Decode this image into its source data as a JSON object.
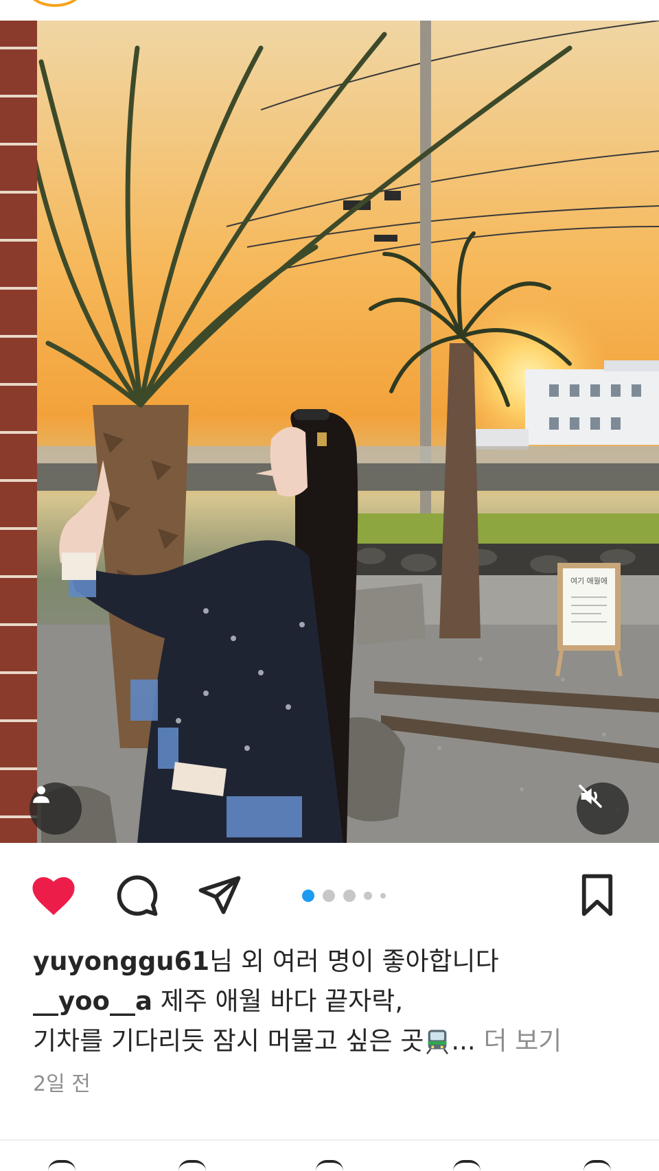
{
  "post": {
    "liked_by_user": "yuyonggu61",
    "liked_by_suffix": "님 외 여러 명이 좋아합니다",
    "author": "__yoo__a",
    "caption_line1": " 제주 애월 바다 끝자락,",
    "caption_line2": "기차를 기다리듯 잠시 머물고 싶은 곳",
    "caption_ellipsis": "...",
    "more_label": "더 보기",
    "time": "2일 전",
    "sign_text": "여기 애월에",
    "liked": true
  },
  "carousel": {
    "total": 5,
    "current": 1
  },
  "colors": {
    "like": "#ed1d49",
    "dot_active": "#1d9bf0",
    "text": "#262626",
    "muted": "#8e8e8e"
  },
  "icons": [
    "story-ring-icon",
    "person-tag-icon",
    "mute-icon",
    "heart-icon",
    "comment-icon",
    "send-icon",
    "bookmark-icon",
    "train-emoji-icon"
  ]
}
